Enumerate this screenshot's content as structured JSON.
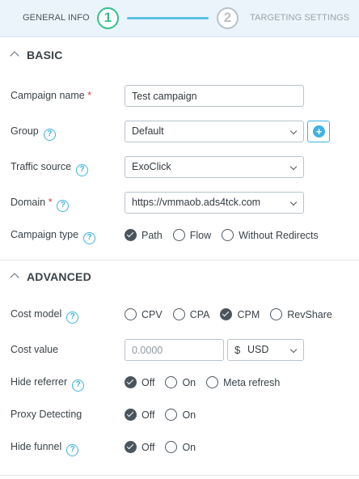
{
  "stepper": {
    "step1": {
      "number": "1",
      "label": "GENERAL INFO"
    },
    "step2": {
      "number": "2",
      "label": "TARGETING SETTINGS"
    }
  },
  "basic": {
    "title": "BASIC",
    "campaign_name": {
      "label": "Campaign name",
      "required": "*",
      "value": "Test campaign"
    },
    "group": {
      "label": "Group",
      "value": "Default"
    },
    "traffic_source": {
      "label": "Traffic source",
      "value": "ExoClick"
    },
    "domain": {
      "label": "Domain",
      "required": "*",
      "value": "https://vmmaob.ads4tck.com"
    },
    "campaign_type": {
      "label": "Campaign type",
      "options": [
        "Path",
        "Flow",
        "Without Redirects"
      ],
      "selected": "Path"
    }
  },
  "advanced": {
    "title": "ADVANCED",
    "cost_model": {
      "label": "Cost model",
      "options": [
        "CPV",
        "CPA",
        "CPM",
        "RevShare"
      ],
      "selected": "CPM"
    },
    "cost_value": {
      "label": "Cost value",
      "placeholder": "0.0000",
      "currency_symbol": "$",
      "currency": "USD"
    },
    "hide_referrer": {
      "label": "Hide referrer",
      "options": [
        "Off",
        "On",
        "Meta refresh"
      ],
      "selected": "Off"
    },
    "proxy_detecting": {
      "label": "Proxy Detecting",
      "options": [
        "Off",
        "On"
      ],
      "selected": "Off"
    },
    "hide_funnel": {
      "label": "Hide funnel",
      "options": [
        "Off",
        "On"
      ],
      "selected": "Off"
    }
  },
  "icons": {
    "help": "?",
    "add": "+"
  },
  "colors": {
    "accent_green": "#33c188",
    "accent_blue": "#3fb2e0",
    "required_red": "#e23b3b"
  }
}
